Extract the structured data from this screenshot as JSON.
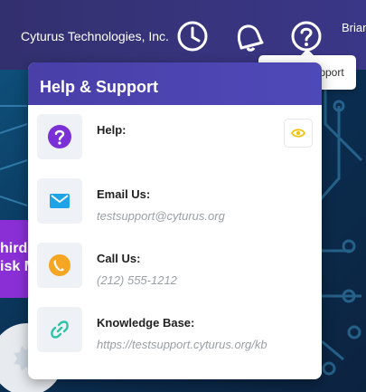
{
  "topbar": {
    "company": "Cyturus Technologies, Inc.",
    "user": "Brian",
    "icons": [
      "clock-icon",
      "bell-icon",
      "help-icon"
    ]
  },
  "tooltip": {
    "text": "Help & Support"
  },
  "background": {
    "promo_text": "hirds\nisk M"
  },
  "panel": {
    "title": "Help & Support",
    "items": [
      {
        "icon": "question-icon",
        "label": "Help:",
        "value": "",
        "color": "#7b2fd6"
      },
      {
        "icon": "mail-icon",
        "label": "Email Us:",
        "value": "testsupport@cyturus.org",
        "color": "#1ea3e6"
      },
      {
        "icon": "phone-icon",
        "label": "Call Us:",
        "value": "(212) 555-1212",
        "color": "#f5a623"
      },
      {
        "icon": "link-icon",
        "label": "Knowledge Base:",
        "value": "https://testsupport.cyturus.org/kb",
        "color": "#2ec4a6"
      }
    ]
  },
  "colors": {
    "topbar": "#3b3788",
    "panel_header": "#4a3fa8",
    "eye_accent": "#f1c40f"
  }
}
